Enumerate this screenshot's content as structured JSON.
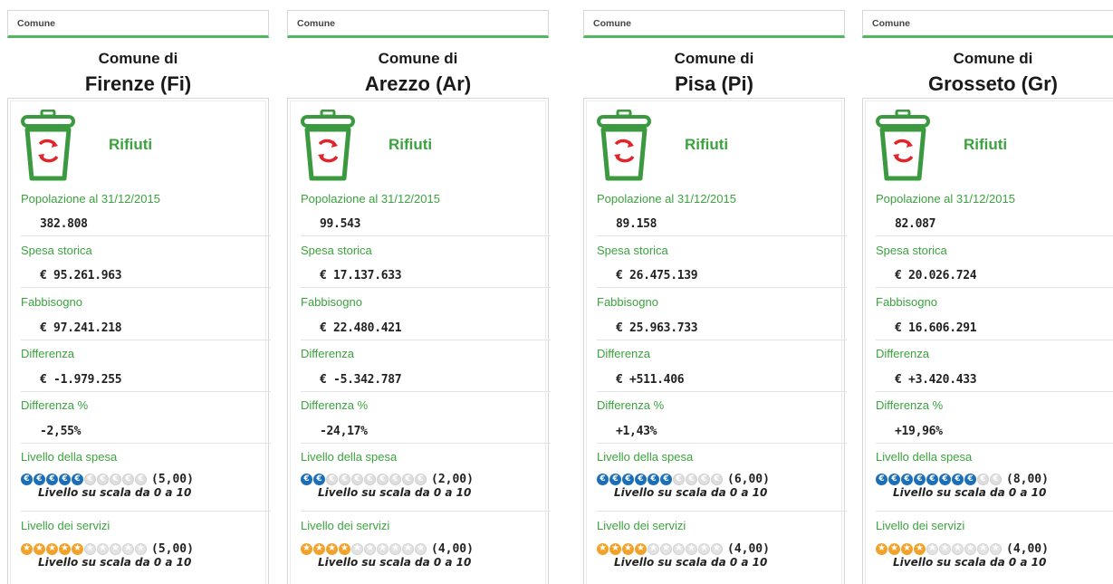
{
  "columns": [
    {
      "selector_label": "Comune",
      "title_prefix": "Comune di",
      "city": "Firenze (Fi)",
      "section": "Rifiuti",
      "popolazione_label": "Popolazione al 31/12/2015",
      "popolazione": "382.808",
      "spesa_label": "Spesa storica",
      "spesa": "€ 95.261.963",
      "fabbisogno_label": "Fabbisogno",
      "fabbisogno": "€ 97.241.218",
      "differenza_label": "Differenza",
      "differenza": "€ -1.979.255",
      "differenza_pct_label": "Differenza %",
      "differenza_pct": "-2,55%",
      "livello_spesa_label": "Livello della spesa",
      "livello_spesa": 5,
      "livello_spesa_text": "(5,00)",
      "livello_servizi_label": "Livello dei servizi",
      "livello_servizi": 5,
      "livello_servizi_text": "(5,00)",
      "scale_note": "Livello su scala da 0 a 10"
    },
    {
      "selector_label": "Comune",
      "title_prefix": "Comune di",
      "city": "Arezzo (Ar)",
      "section": "Rifiuti",
      "popolazione_label": "Popolazione al 31/12/2015",
      "popolazione": "99.543",
      "spesa_label": "Spesa storica",
      "spesa": "€ 17.137.633",
      "fabbisogno_label": "Fabbisogno",
      "fabbisogno": "€ 22.480.421",
      "differenza_label": "Differenza",
      "differenza": "€ -5.342.787",
      "differenza_pct_label": "Differenza %",
      "differenza_pct": "-24,17%",
      "livello_spesa_label": "Livello della spesa",
      "livello_spesa": 2,
      "livello_spesa_text": "(2,00)",
      "livello_servizi_label": "Livello dei servizi",
      "livello_servizi": 4,
      "livello_servizi_text": "(4,00)",
      "scale_note": "Livello su scala da 0 a 10"
    },
    {
      "selector_label": "Comune",
      "title_prefix": "Comune di",
      "city": "Pisa (Pi)",
      "section": "Rifiuti",
      "popolazione_label": "Popolazione al 31/12/2015",
      "popolazione": "89.158",
      "spesa_label": "Spesa storica",
      "spesa": "€ 26.475.139",
      "fabbisogno_label": "Fabbisogno",
      "fabbisogno": "€ 25.963.733",
      "differenza_label": "Differenza",
      "differenza": "€ +511.406",
      "differenza_pct_label": "Differenza %",
      "differenza_pct": "+1,43%",
      "livello_spesa_label": "Livello della spesa",
      "livello_spesa": 6,
      "livello_spesa_text": "(6,00)",
      "livello_servizi_label": "Livello dei servizi",
      "livello_servizi": 4,
      "livello_servizi_text": "(4,00)",
      "scale_note": "Livello su scala da 0 a 10"
    },
    {
      "selector_label": "Comune",
      "title_prefix": "Comune di",
      "city": "Grosseto (Gr)",
      "section": "Rifiuti",
      "popolazione_label": "Popolazione al 31/12/2015",
      "popolazione": "82.087",
      "spesa_label": "Spesa storica",
      "spesa": "€ 20.026.724",
      "fabbisogno_label": "Fabbisogno",
      "fabbisogno": "€ 16.606.291",
      "differenza_label": "Differenza",
      "differenza": "€ +3.420.433",
      "differenza_pct_label": "Differenza %",
      "differenza_pct": "+19,96%",
      "livello_spesa_label": "Livello della spesa",
      "livello_spesa": 8,
      "livello_spesa_text": "(8,00)",
      "livello_servizi_label": "Livello dei servizi",
      "livello_servizi": 4,
      "livello_servizi_text": "(4,00)",
      "scale_note": "Livello su scala da 0 a 10"
    }
  ],
  "rating_max": 10,
  "icons": {
    "section": "recycling-bin-icon",
    "spesa_unit": "euro-coin-icon",
    "servizi_unit": "star-icon"
  },
  "colors": {
    "accent_green": "#3aa33d",
    "bin_green": "#3b9a3f",
    "recycle_red": "#e0262a",
    "coin_blue": "#1b6fb8",
    "star_orange": "#f2a229"
  }
}
